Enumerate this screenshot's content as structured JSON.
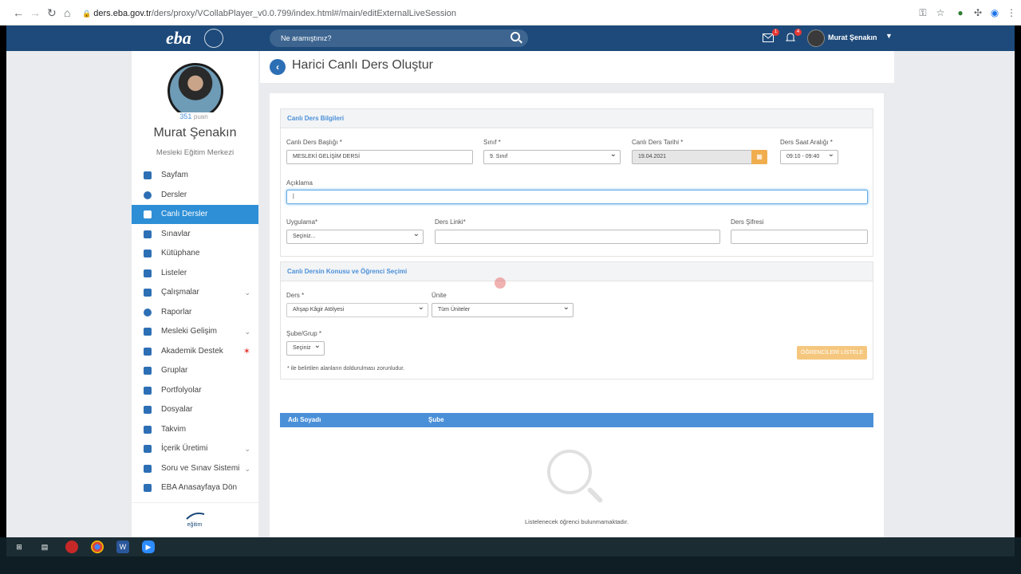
{
  "browser": {
    "url_prefix": "ders.eba.gov.tr",
    "url_path": "/ders/proxy/VCollabPlayer_v0.0.799/index.html#/main/editExternalLiveSession"
  },
  "topbar": {
    "logo": "eba",
    "search_placeholder": "Ne aramıştınız?",
    "mail_badge": "1",
    "bell_badge": "4",
    "user_name": "Murat Şenakın"
  },
  "profile": {
    "points": "351",
    "points_unit": "puan",
    "name": "Murat Şenakın",
    "school": "Mesleki Eğitim Merkezi"
  },
  "sidebar": {
    "items": [
      {
        "label": "Sayfam"
      },
      {
        "label": "Dersler"
      },
      {
        "label": "Canlı Dersler"
      },
      {
        "label": "Sınavlar"
      },
      {
        "label": "Kütüphane"
      },
      {
        "label": "Listeler"
      },
      {
        "label": "Çalışmalar"
      },
      {
        "label": "Raporlar"
      },
      {
        "label": "Mesleki Gelişim"
      },
      {
        "label": "Akademik Destek"
      },
      {
        "label": "Gruplar"
      },
      {
        "label": "Portfolyolar"
      },
      {
        "label": "Dosyalar"
      },
      {
        "label": "Takvim"
      },
      {
        "label": "İçerik Üretimi"
      },
      {
        "label": "Soru ve Sınav Sistemi"
      },
      {
        "label": "EBA Anasayfaya Dön"
      }
    ],
    "footer_logo": "eğitim"
  },
  "page": {
    "title": "Harici Canlı Ders Oluştur"
  },
  "section1": {
    "title": "Canlı Ders Bilgileri",
    "baslik_label": "Canlı Ders Başlığı *",
    "baslik_value": "MESLEKİ GELİŞİM DERSİ",
    "sinif_label": "Sınıf *",
    "sinif_value": "9. Sınıf",
    "tarih_label": "Canlı Ders Tarihi *",
    "tarih_value": "19.04.2021",
    "saat_label": "Ders Saat Aralığı *",
    "saat_value": "09:10 - 09:40",
    "aciklama_label": "Açıklama",
    "aciklama_value": "|",
    "uygulama_label": "Uygulama*",
    "uygulama_value": "Seçiniz...",
    "link_label": "Ders Linki*",
    "link_value": "",
    "sifre_label": "Ders Şifresi",
    "sifre_value": ""
  },
  "section2": {
    "title": "Canlı Dersin Konusu ve Öğrenci Seçimi",
    "ders_label": "Ders *",
    "ders_value": "Ahşap Kâgir Atölyesi",
    "unite_label": "Ünite",
    "unite_value": "Tüm Üniteler",
    "sube_label": "Şube/Grup *",
    "sube_value": "Seçiniz",
    "list_button": "ÖĞRENCİLERİ LİSTELE",
    "note": "* ile belirtilen alanların doldurulması zorunludur."
  },
  "table": {
    "col1": "Adı Soyadı",
    "col2": "Şube",
    "empty_text": "Listelenecek öğrenci bulunmamaktadır."
  }
}
